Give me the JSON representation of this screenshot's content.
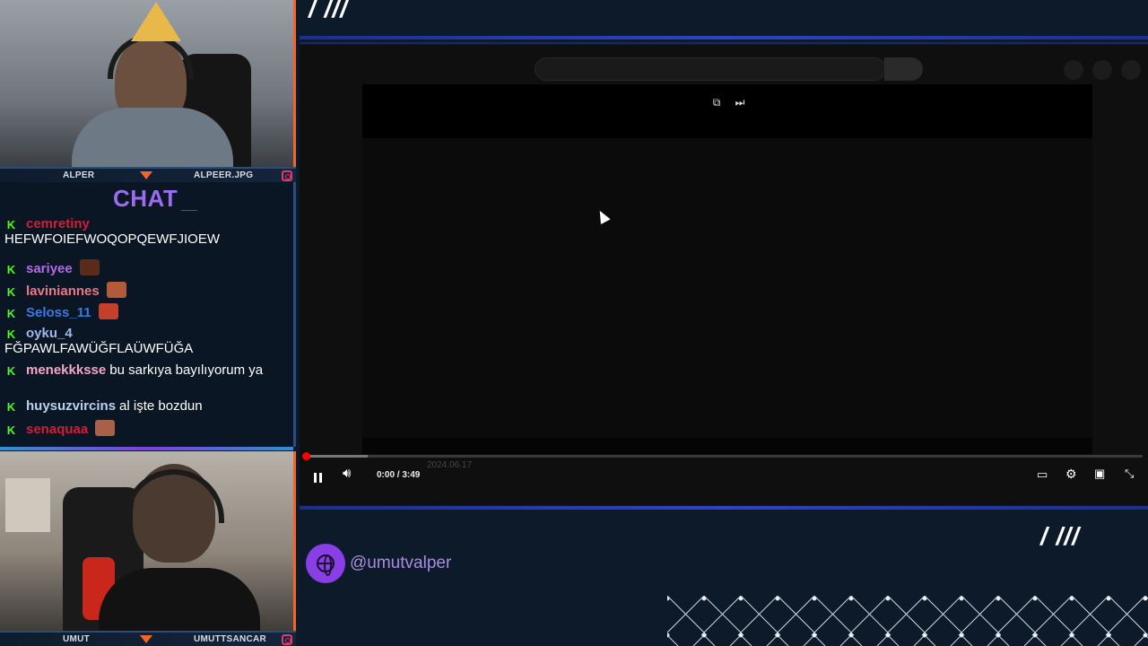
{
  "streamers": {
    "top": {
      "left_name": "ALPER",
      "right_name": "ALPEER.JPG"
    },
    "bottom": {
      "left_name": "UMUT",
      "right_name": "UMUTTSANCAR"
    }
  },
  "chat": {
    "title": "CHAT",
    "messages": [
      {
        "user": "cemretiny",
        "color": "#d11f3a",
        "text": "",
        "second_line": "HEFWFOIEFWOQOPQEWFJIOEW",
        "emote": false
      },
      {
        "user": "sariyee",
        "color": "#b06be6",
        "text": "",
        "second_line": "",
        "emote": true,
        "emote_color": "#5a2a1a"
      },
      {
        "user": "laviniannes",
        "color": "#e67a8a",
        "text": "",
        "second_line": "",
        "emote": true,
        "emote_color": "#b35a3a"
      },
      {
        "user": "Seloss_11",
        "color": "#3b7be0",
        "text": "",
        "second_line": "",
        "emote": true,
        "emote_color": "#c4402a"
      },
      {
        "user": "oyku_4",
        "color": "#9fb8e8",
        "text": "",
        "second_line": "FĞPAWLFAWÜĞFLAÜWFÜĞA",
        "emote": false
      },
      {
        "user": "menekkksse",
        "color": "#f3a6c8",
        "text": "bu sarkıya bayılıyorum ya",
        "second_line": "",
        "emote": false
      },
      {
        "user": "huysuzvircins",
        "color": "#b7d3f0",
        "text": "al işte bozdun",
        "second_line": "",
        "emote": false
      },
      {
        "user": "senaquaa",
        "color": "#d11f3a",
        "text": "",
        "second_line": "",
        "emote": true,
        "emote_color": "#a86048"
      }
    ]
  },
  "decor": {
    "slashes_top": "/ ///",
    "slashes_bottom": "/ ///"
  },
  "player": {
    "time": "0:00 / 3:49",
    "date": "2024.06.17",
    "progress": 0.002,
    "buffered": 0.075
  },
  "social": {
    "handle": "@umutvalper"
  },
  "colors": {
    "accent_orange": "#f1652a",
    "accent_purple": "#8a3ee6",
    "accent_blue": "#2a45c8",
    "kick_green": "#53fc18"
  }
}
